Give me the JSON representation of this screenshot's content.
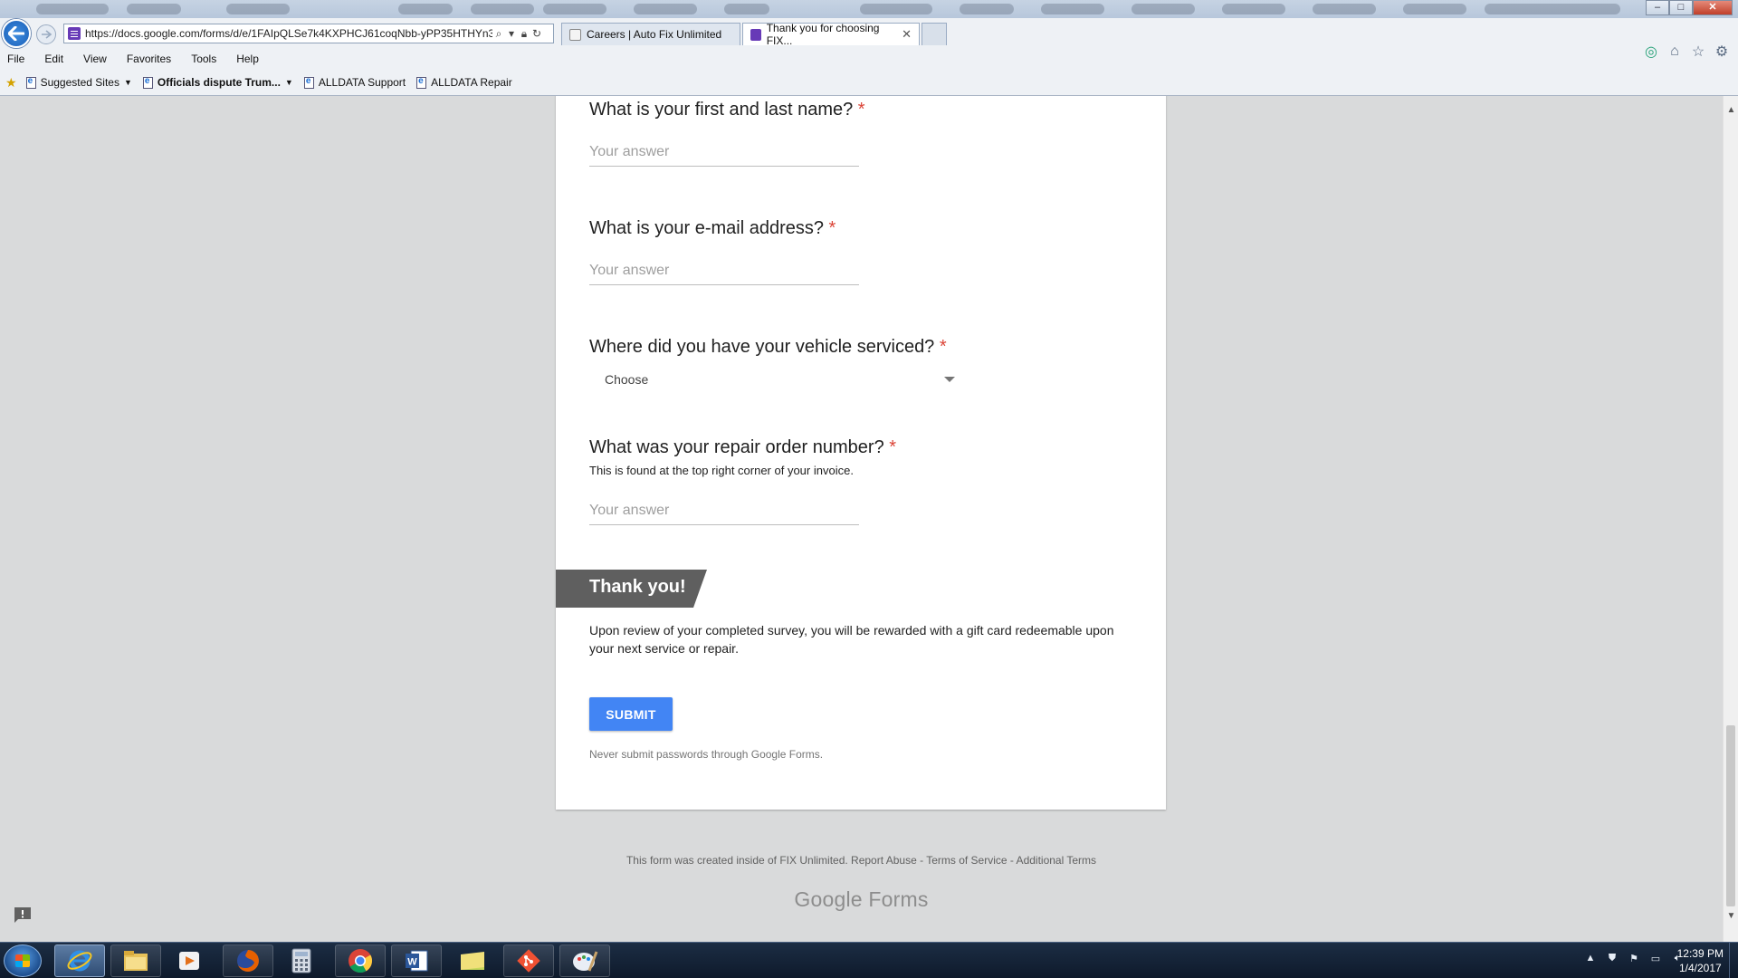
{
  "browser": {
    "url": "https://docs.google.com/forms/d/e/1FAIpQLSe7k4KXPHCJ61coqNbb-yPP35HTHYn3",
    "tabs": [
      {
        "label": "Careers | Auto Fix Unlimited",
        "active": false
      },
      {
        "label": "Thank you for choosing FIX...",
        "active": true
      }
    ],
    "menu": [
      "File",
      "Edit",
      "View",
      "Favorites",
      "Tools",
      "Help"
    ],
    "favorites": [
      {
        "label": "Suggested Sites",
        "dropdown": true,
        "bold": false
      },
      {
        "label": "Officials dispute Trum...",
        "dropdown": true,
        "bold": true
      },
      {
        "label": "ALLDATA Support",
        "dropdown": false,
        "bold": false
      },
      {
        "label": "ALLDATA Repair",
        "dropdown": false,
        "bold": false
      }
    ]
  },
  "form": {
    "questions": [
      {
        "title": "What is your first and last name?",
        "required_mark": "*",
        "placeholder": "Your answer"
      },
      {
        "title": "What is your e-mail address?",
        "required_mark": "*",
        "placeholder": "Your answer"
      },
      {
        "title": "Where did you have your vehicle serviced?",
        "required_mark": "*",
        "select_value": "Choose"
      },
      {
        "title": "What was your repair order number?",
        "required_mark": "*",
        "help": "This is found at the top right corner of your invoice.",
        "placeholder": "Your answer"
      }
    ],
    "section": {
      "title": "Thank you!",
      "description": "Upon review of your completed survey, you will be rewarded with a gift card redeemable upon your next service or repair."
    },
    "submit_label": "SUBMIT",
    "password_warning": "Never submit passwords through Google Forms."
  },
  "footer": {
    "text": "This form was created inside of FIX Unlimited. Report Abuse - Terms of Service - Additional Terms",
    "logo_google": "Google",
    "logo_forms": "Forms"
  },
  "taskbar": {
    "apps": [
      "internet-explorer",
      "file-explorer",
      "media-player",
      "firefox",
      "calculator",
      "chrome",
      "word",
      "folder",
      "git",
      "paint"
    ],
    "active_app": "internet-explorer",
    "time": "12:39 PM",
    "date": "1/4/2017"
  },
  "colors": {
    "accent": "#4285f4",
    "required": "#db4437",
    "section_header": "#5f5f5f",
    "page_bg": "#d9dadb"
  }
}
